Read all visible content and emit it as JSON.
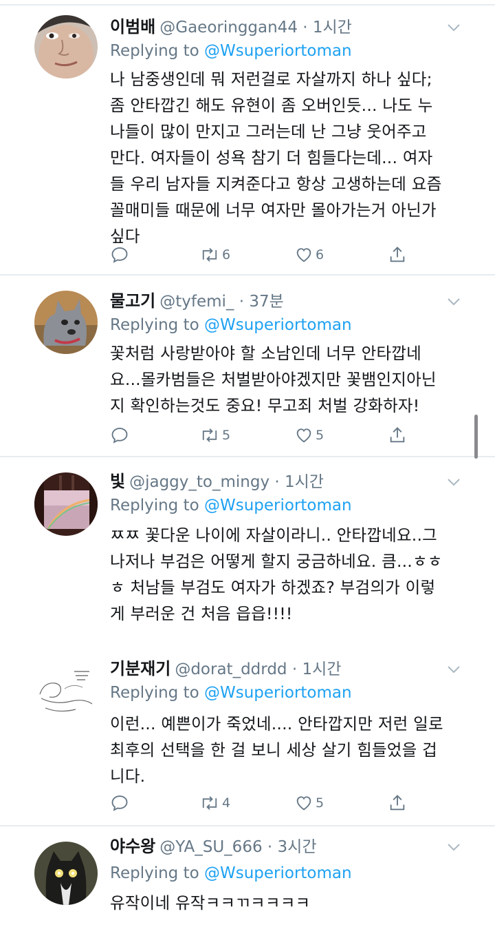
{
  "tweets": [
    {
      "name": "이범배",
      "handle": "@Gaeoringgan44",
      "dot": "·",
      "time": "1시간",
      "replying_prefix": "Replying to ",
      "replying_to": "@Wsuperiortoman",
      "text": "나 남중생인데 뭐 저런걸로 자살까지 하나 싶다;\n좀 안타깝긴 해도 유현이 좀 오버인듯... 나도 누\n나들이 많이 만지고 그러는데 난 그냥 웃어주고\n만다. 여자들이 성욕 참기 더 힘들다는데... 여자\n들 우리 남자들 지켜준다고 항상 고생하는데 요즘\n꼴매미들 때문에 너무 여자만 몰아가는거 아닌가\n싶다",
      "retweets": "6",
      "likes": "6",
      "avatar_icon": "person-face-photo"
    },
    {
      "name": "물고기",
      "handle": "@tyfemi_",
      "dot": "·",
      "time": "37분",
      "replying_prefix": "Replying to ",
      "replying_to": "@Wsuperiortoman",
      "text": "꽃처럼 사랑받아야 할 소남인데 너무 안타깝네\n요...몰카범들은 처벌받아야겠지만 꽃뱀인지아닌\n지 확인하는것도 중요! 무고죄 처벌 강화하자!",
      "retweets": "5",
      "likes": "5",
      "avatar_icon": "dog-photo"
    },
    {
      "name": "빛",
      "handle": "@jaggy_to_mingy",
      "dot": "·",
      "time": "1시간",
      "replying_prefix": "Replying to ",
      "replying_to": "@Wsuperiortoman",
      "text": "ㅉㅉ 꽃다운 나이에 자살이라니.. 안타깝네요..그\n나저나 부검은 어떻게 할지 궁금하네요. 큼...ㅎㅎ\nㅎ 처남들 부검도 여자가 하겠죠? 부검의가 이렇\n게 부러운 건 처음 읍읍!!!!",
      "retweets": "",
      "likes": "",
      "avatar_icon": "train-window-rainbow-photo"
    },
    {
      "name": "기분재기",
      "handle": "@dorat_ddrdd",
      "dot": "·",
      "time": "1시간",
      "replying_prefix": "Replying to ",
      "replying_to": "@Wsuperiortoman",
      "text": "이런... 예쁜이가 죽었네.... 안타깝지만 저런 일로\n최후의 선택을 한 걸 보니 세상 살기 힘들었을 겁\n니다.",
      "retweets": "4",
      "likes": "5",
      "avatar_icon": "line-drawing-sketch"
    },
    {
      "name": "야수왕",
      "handle": "@YA_SU_666",
      "dot": "·",
      "time": "3시간",
      "replying_prefix": "Replying to ",
      "replying_to": "@Wsuperiortoman",
      "text": "유작이네 유작ㅋㅋㄲㅋㅋㅋㅋ",
      "retweets": "",
      "likes": "",
      "avatar_icon": "cat-photo"
    }
  ],
  "colors": {
    "text": "#14171a",
    "secondary": "#657786",
    "link": "#1da1f2",
    "divider": "#e6ecf0"
  }
}
